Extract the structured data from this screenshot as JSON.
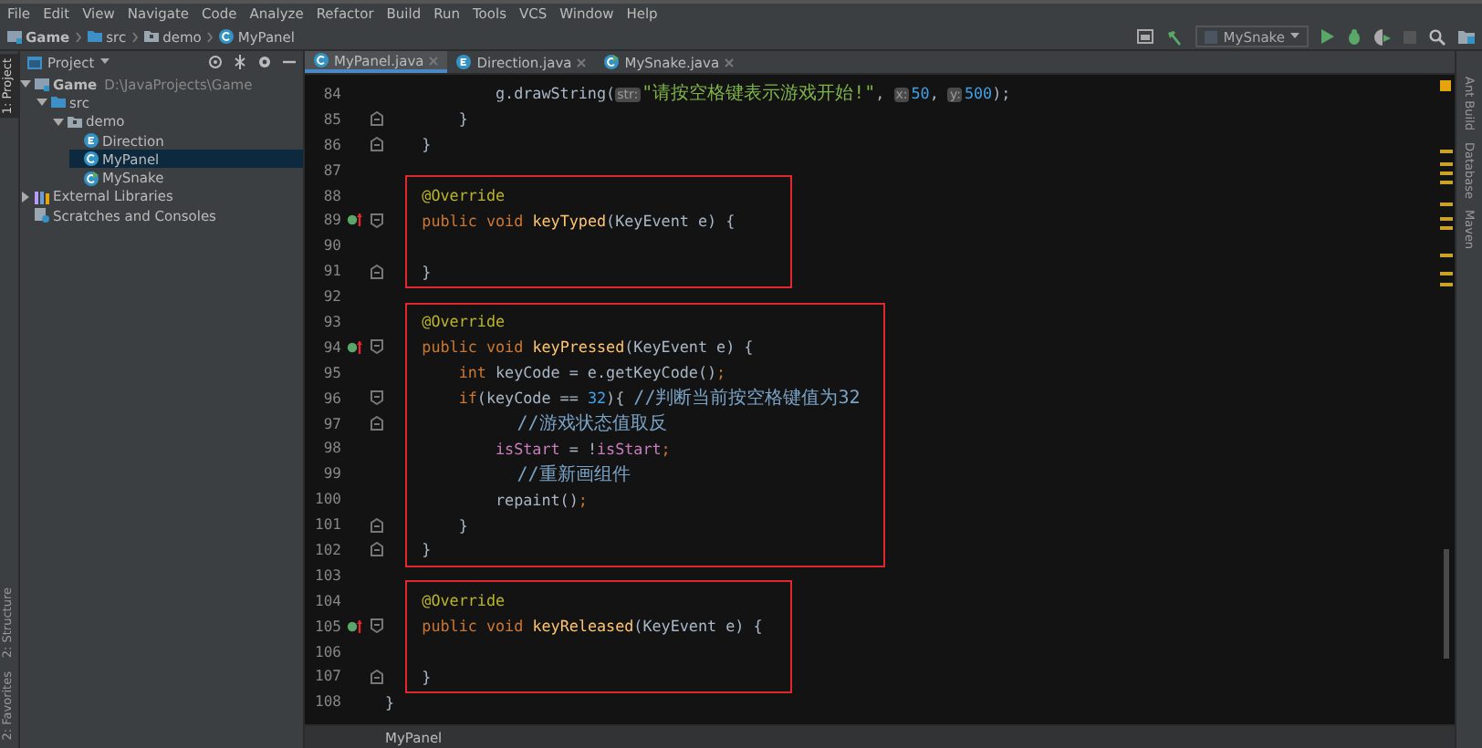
{
  "menu": [
    "File",
    "Edit",
    "View",
    "Navigate",
    "Code",
    "Analyze",
    "Refactor",
    "Build",
    "Run",
    "Tools",
    "VCS",
    "Window",
    "Help"
  ],
  "breadcrumbs": [
    {
      "label": "Game",
      "kind": "project"
    },
    {
      "label": "src",
      "kind": "folder"
    },
    {
      "label": "demo",
      "kind": "package"
    },
    {
      "label": "MyPanel",
      "kind": "class"
    }
  ],
  "run_config": {
    "label": "MySnake"
  },
  "left_stripe": [
    {
      "label": "1: Project",
      "selected": true
    },
    {
      "label": "2: Structure",
      "selected": false
    },
    {
      "label": "2: Favorites",
      "selected": false
    }
  ],
  "right_stripe": [
    "Ant Build",
    "Database",
    "Maven"
  ],
  "project_panel": {
    "title": "Project",
    "tree": [
      {
        "label": "Game",
        "path": "D:\\JavaProjects\\Game",
        "kind": "project",
        "expanded": true,
        "selected": false,
        "children": [
          {
            "label": "src",
            "kind": "folder",
            "expanded": true,
            "selected": false,
            "children": [
              {
                "label": "demo",
                "kind": "package",
                "expanded": true,
                "selected": false,
                "children": [
                  {
                    "label": "Direction",
                    "kind": "enum",
                    "selected": false
                  },
                  {
                    "label": "MyPanel",
                    "kind": "class",
                    "selected": true
                  },
                  {
                    "label": "MySnake",
                    "kind": "main",
                    "selected": false
                  }
                ]
              }
            ]
          }
        ]
      },
      {
        "label": "External Libraries",
        "kind": "library",
        "expanded": false,
        "selected": false
      },
      {
        "label": "Scratches and Consoles",
        "kind": "scratches",
        "selected": false
      }
    ]
  },
  "tabs": [
    {
      "label": "MyPanel.java",
      "kind": "class",
      "selected": true
    },
    {
      "label": "Direction.java",
      "kind": "enum",
      "selected": false
    },
    {
      "label": "MySnake.java",
      "kind": "main",
      "selected": false
    }
  ],
  "code": [
    {
      "boxed": false,
      "lines": [
        {
          "number": "84",
          "tokens": [
            {
              "kind": "plain",
              "text": "            g.drawString("
            },
            {
              "kind": "hint",
              "text": "str:"
            },
            {
              "kind": "string",
              "text": "\"请按空格键表示游戏开始!\""
            },
            {
              "kind": "plain",
              "text": ", "
            },
            {
              "kind": "hint",
              "text": "x:"
            },
            {
              "kind": "number",
              "text": "50"
            },
            {
              "kind": "plain",
              "text": ", "
            },
            {
              "kind": "hint",
              "text": "y:"
            },
            {
              "kind": "number",
              "text": "500"
            },
            {
              "kind": "plain",
              "text": ");"
            }
          ]
        },
        {
          "number": "85",
          "fold_end": true,
          "tokens": [
            {
              "kind": "plain",
              "text": "        }"
            }
          ]
        },
        {
          "number": "86",
          "fold_end": true,
          "tokens": [
            {
              "kind": "plain",
              "text": "    }"
            }
          ]
        },
        {
          "number": "87"
        }
      ]
    },
    {
      "boxed": true,
      "lines": [
        {
          "number": "88",
          "tokens": [
            {
              "kind": "annotation",
              "text": "    @Override"
            }
          ]
        },
        {
          "number": "89",
          "overrides": true,
          "fold_start": true,
          "tokens": [
            {
              "kind": "keyword",
              "text": "    public void "
            },
            {
              "kind": "method",
              "text": "keyTyped"
            },
            {
              "kind": "plain",
              "text": "(KeyEvent e) {"
            }
          ]
        },
        {
          "number": "90"
        },
        {
          "number": "91",
          "fold_end": true,
          "tokens": [
            {
              "kind": "plain",
              "text": "    }"
            }
          ]
        }
      ]
    },
    {
      "boxed": false,
      "lines": [
        {
          "number": "92"
        }
      ]
    },
    {
      "boxed": true,
      "lines": [
        {
          "number": "93",
          "tokens": [
            {
              "kind": "annotation",
              "text": "    @Override"
            }
          ]
        },
        {
          "number": "94",
          "overrides": true,
          "fold_start": true,
          "tokens": [
            {
              "kind": "keyword",
              "text": "    public void "
            },
            {
              "kind": "method",
              "text": "keyPressed"
            },
            {
              "kind": "plain",
              "text": "(KeyEvent e) {"
            }
          ]
        },
        {
          "number": "95",
          "tokens": [
            {
              "kind": "keyword",
              "text": "        int "
            },
            {
              "kind": "plain",
              "text": "keyCode = e.getKeyCode()"
            },
            {
              "kind": "keyword",
              "text": ";"
            }
          ]
        },
        {
          "number": "96",
          "fold_start": true,
          "tokens": [
            {
              "kind": "keyword",
              "text": "        if"
            },
            {
              "kind": "plain",
              "text": "(keyCode == "
            },
            {
              "kind": "number",
              "text": "32"
            },
            {
              "kind": "plain",
              "text": "){ "
            },
            {
              "kind": "comment",
              "text": "//判断当前按空格键值为32"
            }
          ]
        },
        {
          "number": "97",
          "fold_end": true,
          "tokens": [
            {
              "kind": "comment",
              "text": "            //游戏状态值取反"
            }
          ]
        },
        {
          "number": "98",
          "tokens": [
            {
              "kind": "field",
              "text": "            isStart"
            },
            {
              "kind": "plain",
              "text": " = !"
            },
            {
              "kind": "field",
              "text": "isStart"
            },
            {
              "kind": "keyword",
              "text": ";"
            }
          ]
        },
        {
          "number": "99",
          "tokens": [
            {
              "kind": "comment",
              "text": "            //重新画组件"
            }
          ]
        },
        {
          "number": "100",
          "tokens": [
            {
              "kind": "plain",
              "text": "            repaint()"
            },
            {
              "kind": "keyword",
              "text": ";"
            }
          ]
        },
        {
          "number": "101",
          "fold_end": true,
          "tokens": [
            {
              "kind": "plain",
              "text": "        }"
            }
          ]
        },
        {
          "number": "102",
          "fold_end": true,
          "tokens": [
            {
              "kind": "plain",
              "text": "    }"
            }
          ]
        }
      ]
    },
    {
      "boxed": false,
      "lines": [
        {
          "number": "103"
        }
      ]
    },
    {
      "boxed": true,
      "lines": [
        {
          "number": "104",
          "tokens": [
            {
              "kind": "annotation",
              "text": "    @Override"
            }
          ]
        },
        {
          "number": "105",
          "overrides": true,
          "fold_start": true,
          "tokens": [
            {
              "kind": "keyword",
              "text": "    public void "
            },
            {
              "kind": "method",
              "text": "keyReleased"
            },
            {
              "kind": "plain",
              "text": "(KeyEvent e) {"
            }
          ]
        },
        {
          "number": "106"
        },
        {
          "number": "107",
          "fold_end": true,
          "tokens": [
            {
              "kind": "plain",
              "text": "    }"
            }
          ]
        }
      ]
    },
    {
      "boxed": false,
      "lines": [
        {
          "number": "108",
          "tokens": [
            {
              "kind": "plain",
              "text": "}"
            }
          ]
        }
      ]
    }
  ],
  "editor_breadcrumb": "MyPanel"
}
